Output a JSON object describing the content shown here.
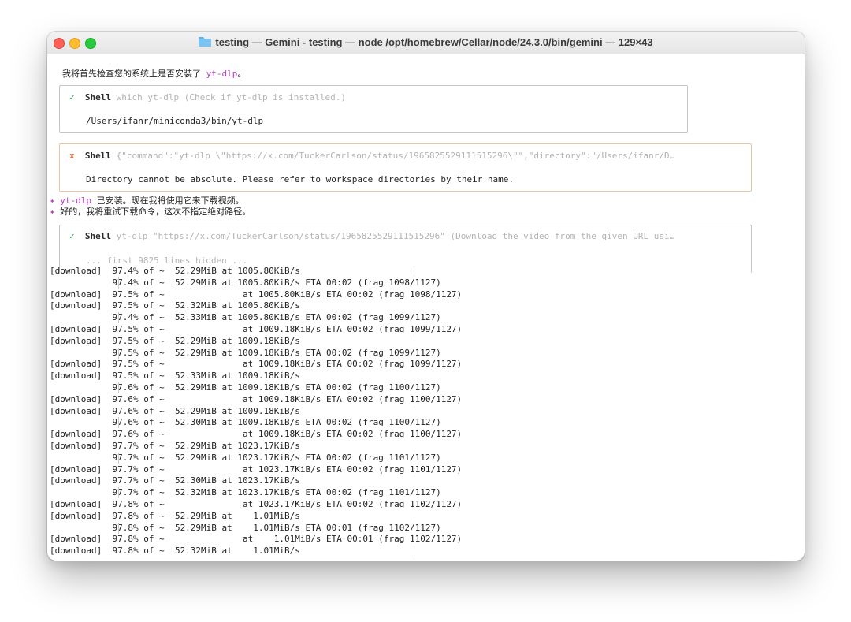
{
  "window": {
    "title": "testing — Gemini - testing — node /opt/homebrew/Cellar/node/24.3.0/bin/gemini — 129×43"
  },
  "intro": {
    "text": "我将首先检查您的系统上是否安装了 ",
    "cmd": "yt-dlp",
    "end": "。"
  },
  "tool1": {
    "status": "✓",
    "label": "Shell",
    "desc": "which yt-dlp (Check if yt-dlp is installed.)",
    "output": "/Users/ifanr/miniconda3/bin/yt-dlp"
  },
  "tool2": {
    "status": "x",
    "label": "Shell",
    "desc": "{\"command\":\"yt-dlp \\\"https://x.com/TuckerCarlson/status/1965825529111515296\\\"\",\"directory\":\"/Users/ifanr/D…",
    "output": "Directory cannot be absolute. Please refer to workspace directories by their name."
  },
  "notes": [
    {
      "bullet": "✦",
      "cmd": "yt-dlp",
      "text": " 已安装。现在我将使用它来下载视频。"
    },
    {
      "bullet": "✦",
      "cmd": "",
      "text": "好的，我将重试下载命令，这次不指定绝对路径。"
    }
  ],
  "tool3": {
    "status": "✓",
    "label": "Shell",
    "desc": "yt-dlp \"https://x.com/TuckerCarlson/status/1965825529111515296\" (Download the video from the given URL usi…",
    "hidden": "... first 9825 lines hidden ..."
  },
  "log": [
    "[download]  97.4% of ~  52.29MiB at 1005.80KiB/s",
    "            97.4% of ~  52.29MiB at 1005.80KiB/s ETA 00:02 (frag 1098/1127)",
    "[download]  97.5% of ~               at 1005.80KiB/s ETA 00:02 (frag 1098/1127)",
    "[download]  97.5% of ~  52.32MiB at 1005.80KiB/s",
    "            97.4% of ~  52.33MiB at 1005.80KiB/s ETA 00:02 (frag 1099/1127)",
    "[download]  97.5% of ~               at 1009.18KiB/s ETA 00:02 (frag 1099/1127)",
    "[download]  97.5% of ~  52.29MiB at 1009.18KiB/s",
    "            97.5% of ~  52.29MiB at 1009.18KiB/s ETA 00:02 (frag 1099/1127)",
    "[download]  97.5% of ~               at 1009.18KiB/s ETA 00:02 (frag 1099/1127)",
    "[download]  97.5% of ~  52.33MiB at 1009.18KiB/s",
    "            97.6% of ~  52.29MiB at 1009.18KiB/s ETA 00:02 (frag 1100/1127)",
    "[download]  97.6% of ~               at 1009.18KiB/s ETA 00:02 (frag 1100/1127)",
    "[download]  97.6% of ~  52.29MiB at 1009.18KiB/s",
    "            97.6% of ~  52.30MiB at 1009.18KiB/s ETA 00:02 (frag 1100/1127)",
    "[download]  97.6% of ~               at 1009.18KiB/s ETA 00:02 (frag 1100/1127)",
    "[download]  97.7% of ~  52.29MiB at 1023.17KiB/s",
    "            97.7% of ~  52.29MiB at 1023.17KiB/s ETA 00:02 (frag 1101/1127)",
    "[download]  97.7% of ~               at 1023.17KiB/s ETA 00:02 (frag 1101/1127)",
    "[download]  97.7% of ~  52.30MiB at 1023.17KiB/s",
    "            97.7% of ~  52.32MiB at 1023.17KiB/s ETA 00:02 (frag 1101/1127)",
    "[download]  97.8% of ~               at 1023.17KiB/s ETA 00:02 (frag 1102/1127)",
    "[download]  97.8% of ~  52.29MiB at    1.01MiB/s",
    "            97.8% of ~  52.29MiB at    1.01MiB/s ETA 00:01 (frag 1102/1127)",
    "[download]  97.8% of ~               at    1.01MiB/s ETA 00:01 (frag 1102/1127)",
    "[download]  97.8% of ~  52.32MiB at    1.01MiB/s"
  ],
  "colors": {
    "accent": "#b43fc2",
    "success": "#2e9e4f",
    "error": "#e0733a"
  }
}
